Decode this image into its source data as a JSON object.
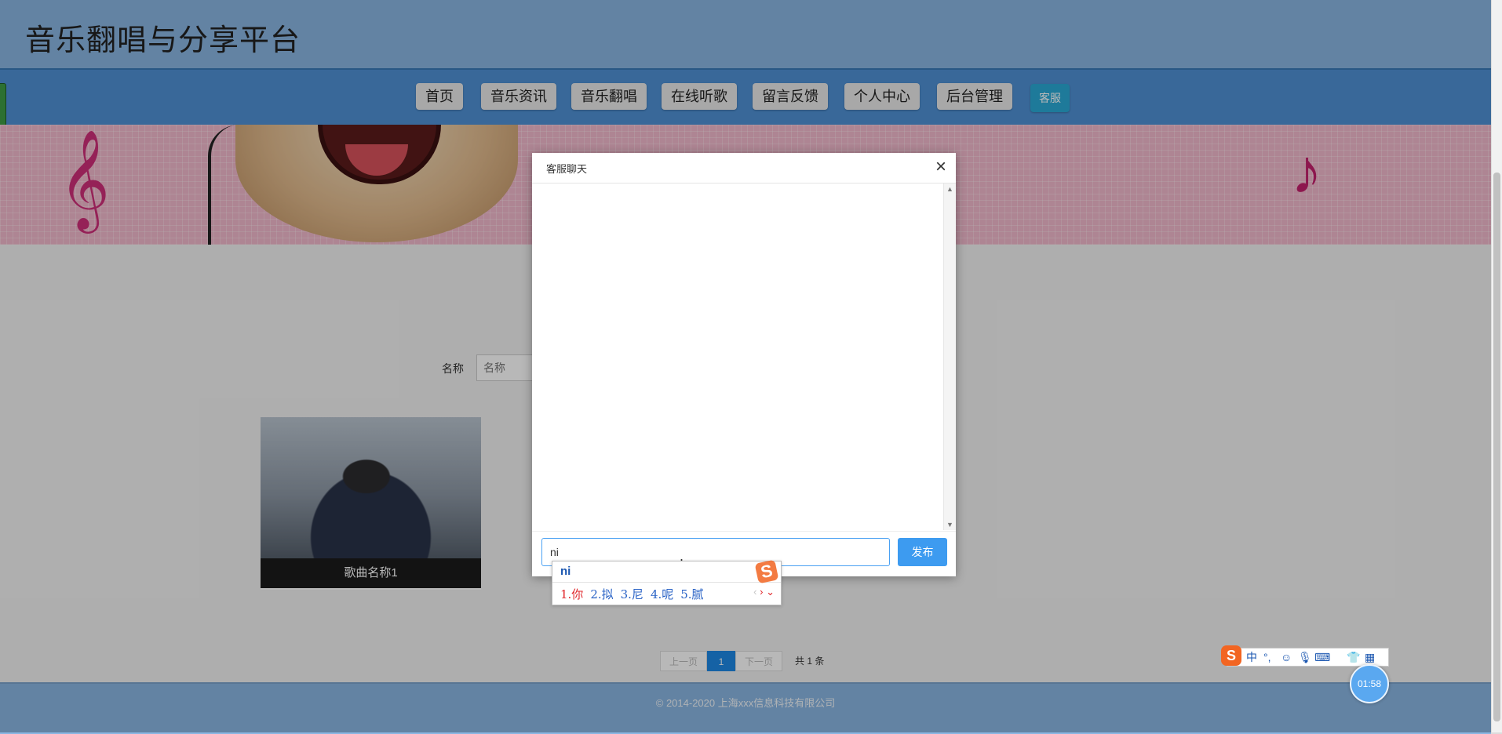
{
  "site": {
    "title": "音乐翻唱与分享平台"
  },
  "nav": {
    "items": [
      "首页",
      "音乐资讯",
      "音乐翻唱",
      "在线听歌",
      "留言反馈",
      "个人中心",
      "后台管理"
    ],
    "service": "客服"
  },
  "search": {
    "label": "名称",
    "placeholder": "名称"
  },
  "songs": [
    {
      "name": "歌曲名称1"
    }
  ],
  "pagination": {
    "prev": "上一页",
    "current": "1",
    "next": "下一页",
    "total": "共 1 条"
  },
  "footer": {
    "copyright": "© 2014-2020 上海xxx信息科技有限公司"
  },
  "chat": {
    "title": "客服聊天",
    "close": "×",
    "input_value": "ni",
    "send": "发布"
  },
  "ime": {
    "composition": "ni",
    "candidates": [
      "1.你",
      "2.拟",
      "3.尼",
      "4.呢",
      "5.腻"
    ],
    "toolbar": [
      "中",
      "°,",
      "☺",
      "🎙",
      "⌨",
      "👕",
      "▦"
    ],
    "logo": "S"
  },
  "timer": "01:58",
  "colors": {
    "header": "#8ab6e2",
    "navbar": "#4f91d5",
    "accent": "#3d9bf0",
    "service_btn": "#2aa9d6"
  }
}
